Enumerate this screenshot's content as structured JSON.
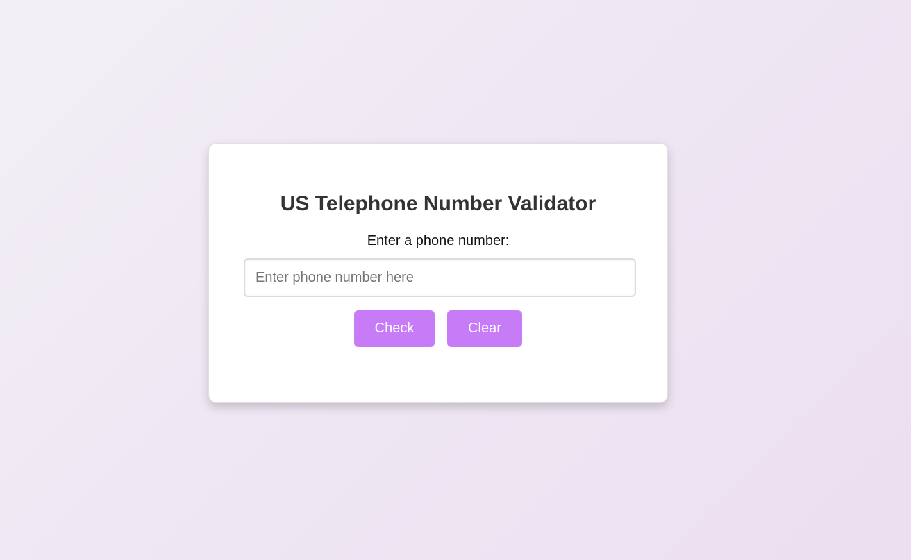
{
  "title": "US Telephone Number Validator",
  "label": "Enter a phone number:",
  "input": {
    "value": "",
    "placeholder": "Enter phone number here"
  },
  "buttons": {
    "check": "Check",
    "clear": "Clear"
  },
  "colors": {
    "accent": "#c87bf6",
    "title": "#333333"
  }
}
